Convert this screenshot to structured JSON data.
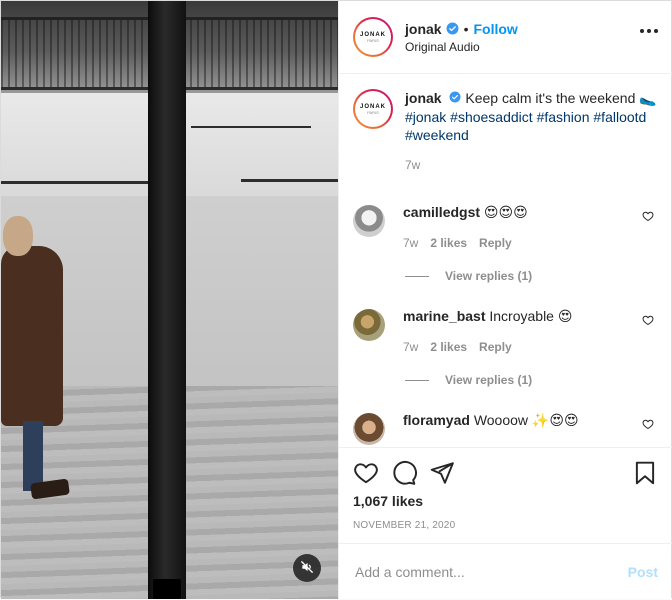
{
  "post": {
    "author": {
      "username": "jonak",
      "verified": true,
      "logo_text": "JONAK",
      "logo_sub": "PARIS"
    },
    "follow_label": "Follow",
    "separator": "•",
    "audio_label": "Original Audio",
    "media": {
      "type": "video",
      "muted": true,
      "mute_icon": "speaker-muted-icon"
    },
    "caption": {
      "text": "Keep calm it's the weekend",
      "emoji": "🥿",
      "hashtags": [
        "#jonak",
        "#shoesaddict",
        "#fashion",
        "#fallootd",
        "#weekend"
      ],
      "age": "7w"
    },
    "comments": [
      {
        "username": "camilledgst",
        "text": "",
        "emoji": "😍😍😍",
        "age": "7w",
        "likes": "2 likes",
        "reply_label": "Reply",
        "view_replies": "View replies (1)"
      },
      {
        "username": "marine_bast",
        "text": "Incroyable",
        "emoji": "😍",
        "age": "7w",
        "likes": "2 likes",
        "reply_label": "Reply",
        "view_replies": "View replies (1)"
      },
      {
        "username": "floramyad",
        "text": "Woooow",
        "emoji": "✨😍😍"
      }
    ],
    "likes_count": "1,067 likes",
    "date": "NOVEMBER 21, 2020",
    "add_comment_placeholder": "Add a comment...",
    "post_button": "Post",
    "colors": {
      "link": "#0095f6",
      "hashtag": "#00376b",
      "muted": "#8e8e8e",
      "post_disabled": "#b2dffc"
    }
  }
}
